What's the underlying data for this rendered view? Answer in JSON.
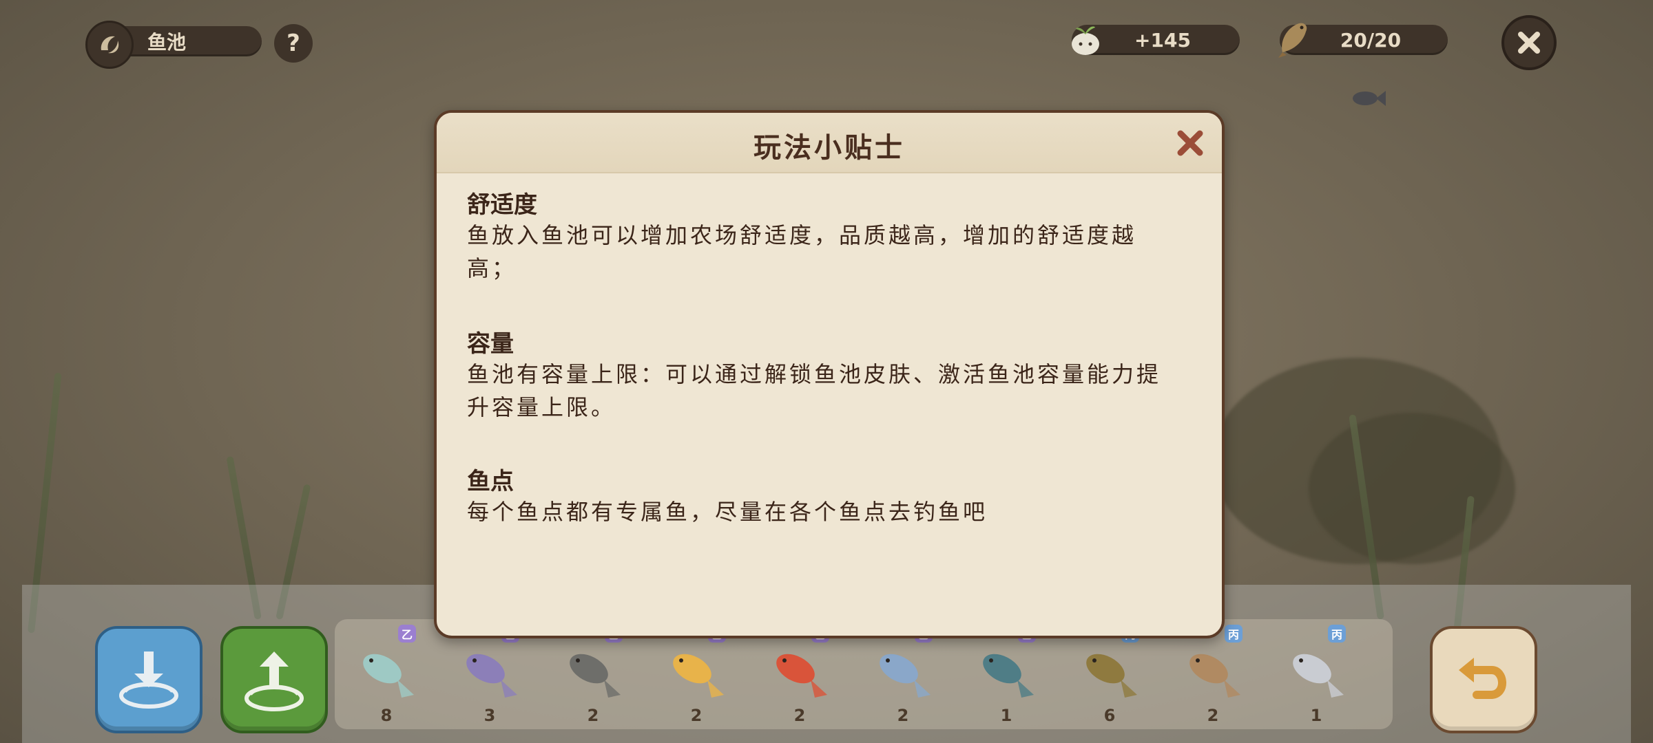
{
  "top_bar": {
    "pond_label": "鱼池",
    "help_symbol": "?",
    "comfort_value": "+145",
    "capacity_value": "20/20"
  },
  "modal": {
    "title": "玩法小贴士",
    "sections": [
      {
        "heading": "舒适度",
        "body": "鱼放入鱼池可以增加农场舒适度，品质越高，增加的舒适度越高；"
      },
      {
        "heading": "容量",
        "body": "鱼池有容量上限：可以通过解锁鱼池皮肤、激活鱼池容量能力提升容量上限。"
      },
      {
        "heading": "鱼点",
        "body": "每个鱼点都有专属鱼，尽量在各个鱼点去钓鱼吧"
      }
    ]
  },
  "fish_list": [
    {
      "grade": "乙",
      "count": "8",
      "color": "#9ec9c4",
      "grade_color": "#9b7fd0"
    },
    {
      "grade": "乙",
      "count": "3",
      "color": "#8c7fb8",
      "grade_color": "#9b7fd0"
    },
    {
      "grade": "乙",
      "count": "2",
      "color": "#6e6e6a",
      "grade_color": "#9b7fd0"
    },
    {
      "grade": "乙",
      "count": "2",
      "color": "#e8b34a",
      "grade_color": "#9b7fd0"
    },
    {
      "grade": "乙",
      "count": "2",
      "color": "#d9543a",
      "grade_color": "#9b7fd0"
    },
    {
      "grade": "乙",
      "count": "2",
      "color": "#8aa7c9",
      "grade_color": "#9b7fd0"
    },
    {
      "grade": "乙",
      "count": "1",
      "color": "#4f7d86",
      "grade_color": "#9b7fd0"
    },
    {
      "grade": "丙",
      "count": "6",
      "color": "#8f7a3f",
      "grade_color": "#6c9fd6"
    },
    {
      "grade": "丙",
      "count": "2",
      "color": "#b08a62",
      "grade_color": "#6c9fd6"
    },
    {
      "grade": "丙",
      "count": "1",
      "color": "#c9ccd2",
      "grade_color": "#6c9fd6"
    }
  ],
  "colors": {
    "store_button": "#5c9fcf",
    "release_button": "#5b9a3c",
    "back_button": "#e9d9bc",
    "back_arrow": "#d99a3a",
    "modal_border": "#5b3b27",
    "close_x": "#9b4d38"
  },
  "icons": {
    "pond": "fish-swirl-icon",
    "comfort": "sprout-icon",
    "capacity": "fish-icon",
    "close": "close-icon",
    "store": "store-fish-icon",
    "release": "release-fish-icon",
    "back": "back-arrow-icon"
  }
}
